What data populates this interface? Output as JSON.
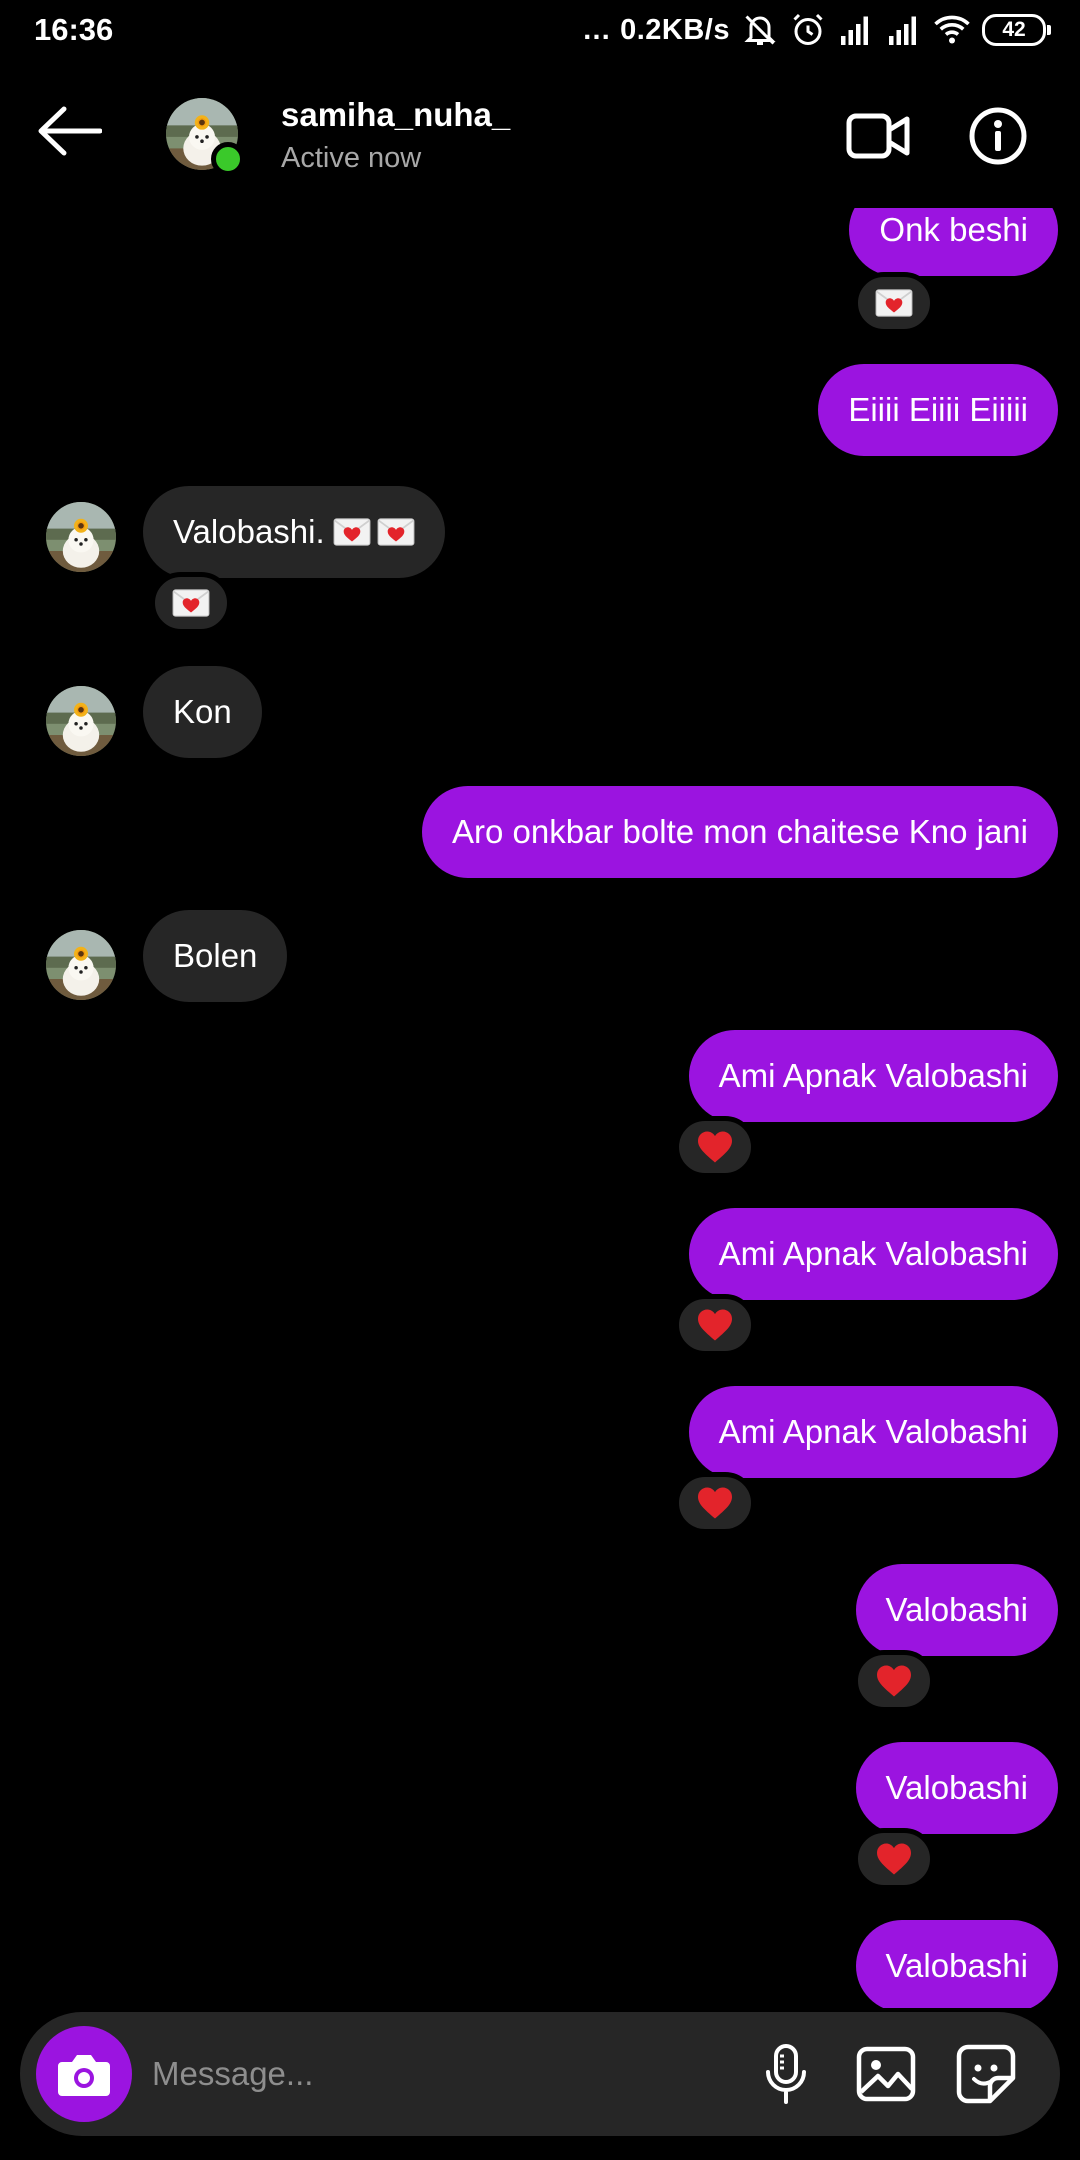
{
  "status_bar": {
    "time": "16:36",
    "network_speed": "… 0.2KB/s",
    "battery": "42",
    "icons": [
      "mute-icon",
      "alarm-icon",
      "signal-icon",
      "signal-icon",
      "wifi-icon",
      "battery-icon"
    ]
  },
  "header": {
    "username": "samiha_nuha_",
    "status": "Active now",
    "icons": [
      "back-arrow-icon",
      "video-call-icon",
      "info-icon"
    ]
  },
  "messages": [
    {
      "side": "out",
      "text": "Onk beshi",
      "reaction": "envelope-heart"
    },
    {
      "side": "out",
      "text": "Eiiii Eiiii Eiiiii"
    },
    {
      "side": "in",
      "text": "Valobashi.",
      "emoji": "envelope-heart x2",
      "reaction": "envelope-heart"
    },
    {
      "side": "in",
      "text": "Kon"
    },
    {
      "side": "out",
      "text": "Aro onkbar bolte mon chaitese Kno jani"
    },
    {
      "side": "in",
      "text": "Bolen"
    },
    {
      "side": "out",
      "text": "Ami Apnak Valobashi",
      "reaction": "red-heart"
    },
    {
      "side": "out",
      "text": "Ami Apnak Valobashi",
      "reaction": "red-heart"
    },
    {
      "side": "out",
      "text": "Ami Apnak Valobashi",
      "reaction": "red-heart"
    },
    {
      "side": "out",
      "text": "Valobashi",
      "reaction": "red-heart"
    },
    {
      "side": "out",
      "text": "Valobashi",
      "reaction": "red-heart"
    },
    {
      "side": "out",
      "text": "Valobashi"
    }
  ],
  "composer": {
    "placeholder": "Message...",
    "icons": [
      "camera-icon",
      "microphone-icon",
      "gallery-icon",
      "sticker-icon"
    ]
  },
  "colors": {
    "background": "#000000",
    "outgoing_bubble": "#9b14e0",
    "incoming_bubble": "#262626",
    "online": "#3ac92a",
    "heart": "#e3242b",
    "secondary_text": "#a8a8a8"
  }
}
